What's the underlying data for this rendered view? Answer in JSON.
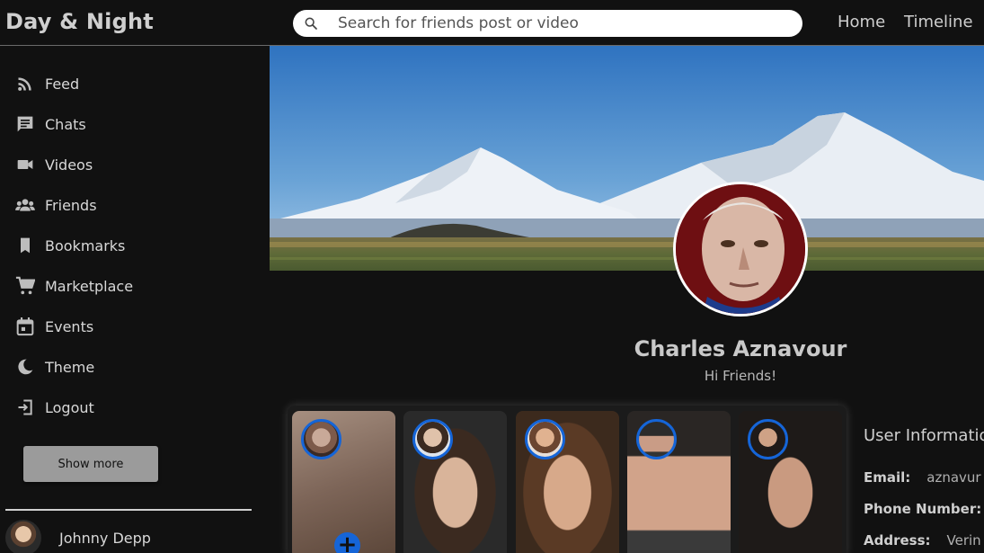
{
  "app": {
    "title": "Day & Night"
  },
  "search": {
    "placeholder": "Search for friends post or video"
  },
  "nav": {
    "home": "Home",
    "timeline": "Timeline"
  },
  "sidebar": {
    "items": [
      {
        "label": "Feed",
        "icon": "rss-icon"
      },
      {
        "label": "Chats",
        "icon": "chat-icon"
      },
      {
        "label": "Videos",
        "icon": "video-icon"
      },
      {
        "label": "Friends",
        "icon": "group-icon"
      },
      {
        "label": "Bookmarks",
        "icon": "bookmark-icon"
      },
      {
        "label": "Marketplace",
        "icon": "cart-icon"
      },
      {
        "label": "Events",
        "icon": "calendar-icon"
      },
      {
        "label": "Theme",
        "icon": "moon-icon"
      },
      {
        "label": "Logout",
        "icon": "logout-icon"
      }
    ],
    "show_more": "Show more",
    "friends": [
      {
        "name": "Johnny Depp"
      }
    ]
  },
  "profile": {
    "name": "Charles Aznavour",
    "status": "Hi Friends!"
  },
  "info": {
    "title": "User Information",
    "email_label": "Email:",
    "email_value": "aznavur",
    "phone_label": "Phone Number:",
    "phone_value": "",
    "address_label": "Address:",
    "address_value": "Verin"
  },
  "colors": {
    "background": "#111111",
    "accent": "#1565d8",
    "button": "#9b9b9b"
  }
}
